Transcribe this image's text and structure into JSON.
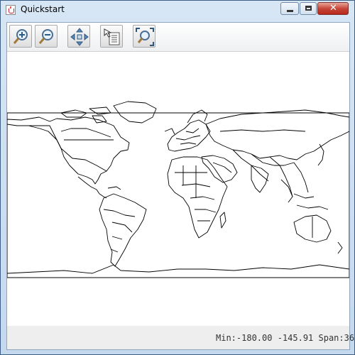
{
  "window": {
    "title": "Quickstart",
    "controls": {
      "minimize": "minimize",
      "maximize": "maximize",
      "close": "✕"
    }
  },
  "toolbar": {
    "tools": [
      {
        "name": "zoom-in",
        "icon": "zoom-in-icon"
      },
      {
        "name": "zoom-out",
        "icon": "zoom-out-icon"
      },
      {
        "name": "pan",
        "icon": "pan-icon"
      },
      {
        "name": "info",
        "icon": "info-icon"
      },
      {
        "name": "reset",
        "icon": "zoom-extent-icon"
      }
    ]
  },
  "map": {
    "layer": "world country borders",
    "line_color": "#000000",
    "background": "#ffffff"
  },
  "status": {
    "text": "Min:-180.00 -145.91 Span:36"
  }
}
